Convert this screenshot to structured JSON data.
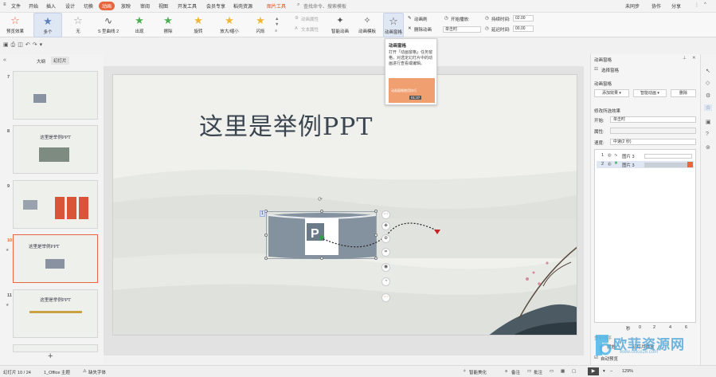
{
  "menu": {
    "file": "文件",
    "tabs": [
      "开始",
      "插入",
      "设计",
      "切换",
      "动画",
      "放映",
      "审阅",
      "视图",
      "开发工具",
      "会员专享",
      "稻壳资源"
    ],
    "active_tab": "动画",
    "picture_tools": "图片工具",
    "search": "查找命令、搜索模板",
    "unsynced": "未同步",
    "collab": "协作",
    "share": "分享"
  },
  "ribbon": {
    "preview": "预览效果",
    "effects": [
      "多个",
      "无",
      "S 型曲线 2",
      "出现",
      "擦除",
      "旋转",
      "放大/缩小",
      "闪烁"
    ],
    "anim_props": "动画属性",
    "text_props": "文本属性",
    "smart_anim": "智能动画",
    "anim_template": "动画模板",
    "anim_pane": "动画窗格",
    "anim_brush": "动画刷",
    "delete_anim": "删除动画",
    "start_play": "开始播放:",
    "start_value": "单击时",
    "duration_label": "持续时间:",
    "duration_value": "02.00",
    "delay_label": "延迟时间:",
    "delay_value": "00.00"
  },
  "tooltip": {
    "title": "动画窗格",
    "body": "打开「动画窗格」任务窗格，对选定幻灯片中的动画进行查看或编辑。",
    "video_caption": "动画窗格使用技巧",
    "video_time": "01:37"
  },
  "left_panel": {
    "outline_tab": "大纲",
    "slides_tab": "幻灯片",
    "thumbs": [
      {
        "num": "7",
        "title": ""
      },
      {
        "num": "8",
        "title": "这里是举例PPT"
      },
      {
        "num": "9",
        "title": ""
      },
      {
        "num": "10",
        "title": "这里是举例PPT"
      },
      {
        "num": "11",
        "title": "这里是举例PPT"
      }
    ],
    "add": "+"
  },
  "slide": {
    "title": "这里是举例PPT",
    "anim_badge": "1"
  },
  "right_panel": {
    "header": "动画窗格",
    "select_pane": "选择窗格",
    "anim_pane_label": "动画窗格",
    "add_effect": "添加效果",
    "smart_anim": "智能动画",
    "delete": "删除",
    "modify_label": "修改所选效果",
    "start_label": "开始:",
    "start_value": "单击时",
    "property_label": "属性:",
    "speed_label": "速度:",
    "speed_value": "中速(2 秒)",
    "items": [
      {
        "num": "1",
        "name": "图片 3"
      },
      {
        "num": "2",
        "name": "图片 3"
      }
    ],
    "ruler_label": "秒",
    "ruler_ticks": [
      "0",
      "2",
      "4",
      "6"
    ],
    "reorder": "重新排序",
    "play": "播放",
    "slideshow": "幻灯片播放",
    "autopreview": "自动预览"
  },
  "status": {
    "slide_info": "幻灯片 10 / 24",
    "theme": "1_Office 主题",
    "missing_font": "缺失字体",
    "beautify": "智能美化",
    "notes": "备注",
    "comment": "批注",
    "zoom": "129%"
  },
  "watermark": {
    "text": "欧菲资源网",
    "url": "www.office26.com"
  },
  "colors": {
    "accent": "#e8663d",
    "green_star": "#4caf50",
    "red_star": "#e0443a"
  }
}
